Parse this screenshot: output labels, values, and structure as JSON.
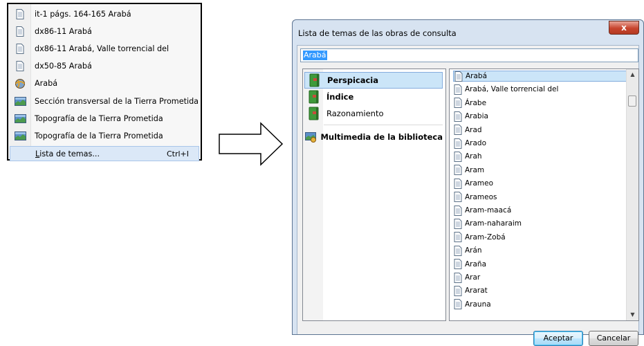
{
  "context_menu": {
    "items": [
      {
        "label": "it-1 págs. 164-165 Arabá",
        "icon": "document-icon"
      },
      {
        "label": "dx86-11 Arabá",
        "icon": "document-icon"
      },
      {
        "label": "dx86-11 Arabá, Valle torrencial del",
        "icon": "document-icon"
      },
      {
        "label": "dx50-85 Arabá",
        "icon": "document-icon"
      },
      {
        "label": "Arabá",
        "icon": "globe-icon"
      },
      {
        "label": "Sección transversal de la Tierra Prometida",
        "icon": "map-image-icon"
      },
      {
        "label": "Topografía de la Tierra Prometida",
        "icon": "map-image-icon"
      },
      {
        "label": "Topografía de la Tierra Prometida",
        "icon": "map-image-icon"
      }
    ],
    "highlighted": {
      "label_accel": "L",
      "label_rest": "ista de temas...",
      "shortcut": "Ctrl+I"
    }
  },
  "dialog": {
    "title": "Lista de temas de las obras de consulta",
    "close_label": "x",
    "search": {
      "value": "Arabá"
    },
    "publications": [
      {
        "label": "Perspicacia",
        "bold": true,
        "selected": true,
        "icon": "green-book-icon"
      },
      {
        "label": "Índice",
        "bold": true,
        "selected": false,
        "icon": "green-book-icon"
      },
      {
        "label": "Razonamiento",
        "bold": false,
        "selected": false,
        "icon": "green-book-icon"
      },
      {
        "label": "Multimedia de la biblioteca",
        "bold": true,
        "selected": false,
        "icon": "media-icon"
      }
    ],
    "topics": [
      "Arabá",
      "Arabá, Valle torrencial del",
      "Árabe",
      "Arabia",
      "Arad",
      "Arado",
      "Arah",
      "Aram",
      "Arameo",
      "Arameos",
      "Aram-maacá",
      "Aram-naharaim",
      "Aram-Zobá",
      "Arán",
      "Araña",
      "Arar",
      "Ararat",
      "Arauna"
    ],
    "selected_topic_index": 0,
    "ok_label": "Aceptar",
    "cancel_label": "Cancelar"
  },
  "colors": {
    "menu_highlight": "#dbe8f7",
    "selection": "#cbe5f8",
    "close_button": "#c7452e",
    "dialog_frame": "#d7e3f1"
  }
}
